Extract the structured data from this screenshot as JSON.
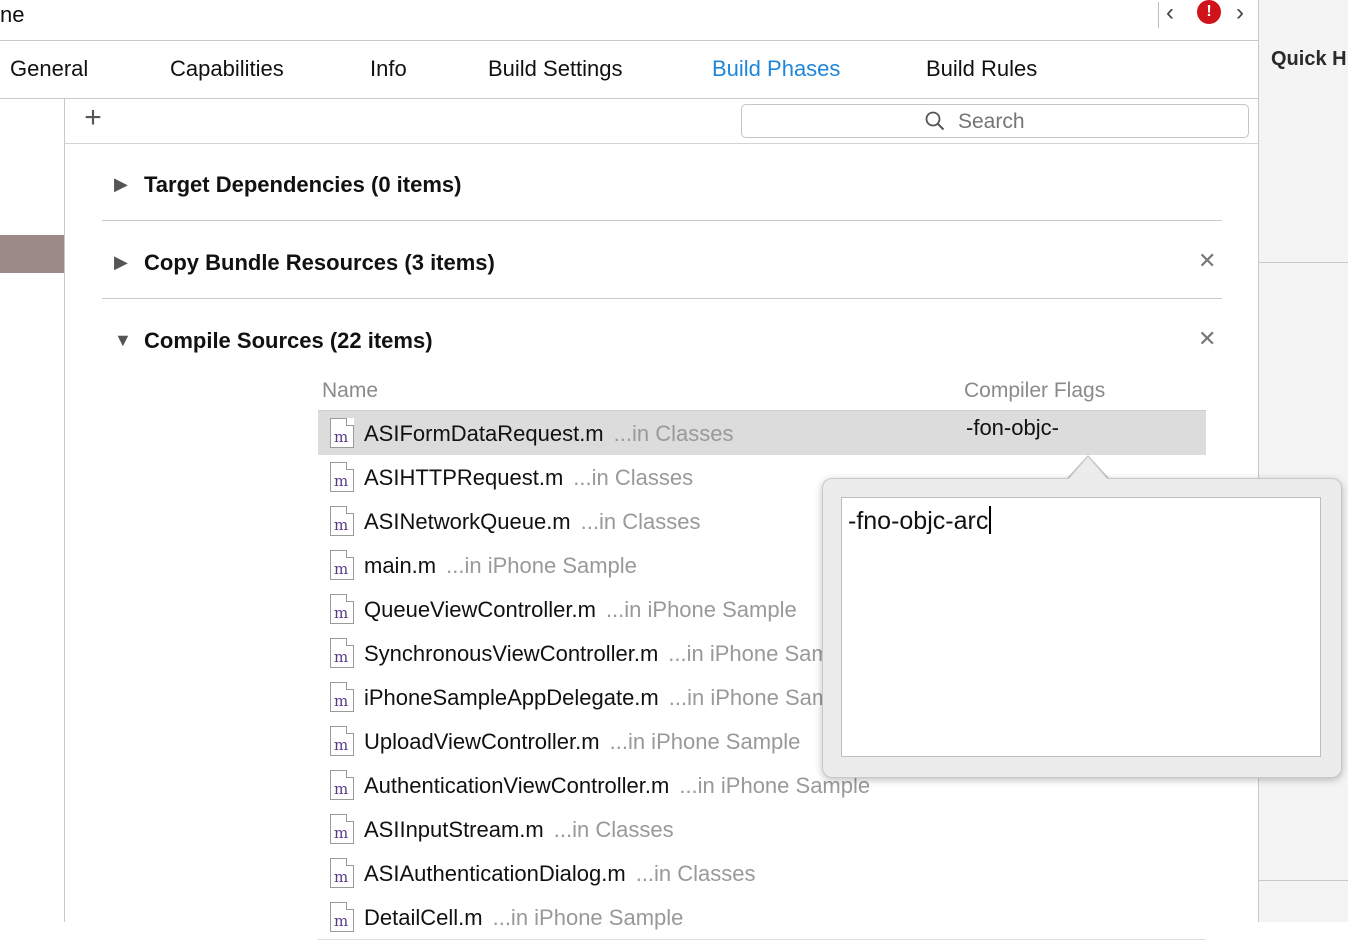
{
  "toolbar": {
    "title_fragment": "ne",
    "nav_back": "‹",
    "error_badge": "!",
    "nav_forward": "›"
  },
  "tabs": [
    {
      "label": "General",
      "active": false
    },
    {
      "label": "Capabilities",
      "active": false
    },
    {
      "label": "Info",
      "active": false
    },
    {
      "label": "Build Settings",
      "active": false
    },
    {
      "label": "Build Phases",
      "active": true
    },
    {
      "label": "Build Rules",
      "active": false
    }
  ],
  "inspector": {
    "title": "Quick H"
  },
  "editor": {
    "add_label": "+",
    "search_placeholder": "Search"
  },
  "phases": [
    {
      "title": "Target Dependencies (0 items)",
      "expanded": false,
      "closable": false
    },
    {
      "title": "Copy Bundle Resources (3 items)",
      "expanded": false,
      "closable": true
    },
    {
      "title": "Compile Sources (22 items)",
      "expanded": true,
      "closable": true
    }
  ],
  "compile_table": {
    "col_name": "Name",
    "col_flags": "Compiler Flags",
    "rows": [
      {
        "icon": "m",
        "file": "ASIFormDataRequest.m",
        "location": "...in Classes",
        "flags": "-fon-objc-",
        "selected": true
      },
      {
        "icon": "m",
        "file": "ASIHTTPRequest.m",
        "location": "...in Classes",
        "flags": "",
        "selected": false
      },
      {
        "icon": "m",
        "file": "ASINetworkQueue.m",
        "location": "...in Classes",
        "flags": "",
        "selected": false
      },
      {
        "icon": "m",
        "file": "main.m",
        "location": "...in iPhone Sample",
        "flags": "",
        "selected": false
      },
      {
        "icon": "m",
        "file": "QueueViewController.m",
        "location": "...in iPhone Sample",
        "flags": "",
        "selected": false
      },
      {
        "icon": "m",
        "file": "SynchronousViewController.m",
        "location": "...in iPhone Sample",
        "flags": "",
        "selected": false
      },
      {
        "icon": "m",
        "file": "iPhoneSampleAppDelegate.m",
        "location": "...in iPhone Sample",
        "flags": "",
        "selected": false
      },
      {
        "icon": "m",
        "file": "UploadViewController.m",
        "location": "...in iPhone Sample",
        "flags": "",
        "selected": false
      },
      {
        "icon": "m",
        "file": "AuthenticationViewController.m",
        "location": "...in iPhone Sample",
        "flags": "",
        "selected": false
      },
      {
        "icon": "m",
        "file": "ASIInputStream.m",
        "location": "...in Classes",
        "flags": "",
        "selected": false
      },
      {
        "icon": "m",
        "file": "ASIAuthenticationDialog.m",
        "location": "...in Classes",
        "flags": "",
        "selected": false
      },
      {
        "icon": "m",
        "file": "DetailCell.m",
        "location": "...in iPhone Sample",
        "flags": "",
        "selected": false
      }
    ]
  },
  "popover": {
    "flags_value": "-fno-objc-arc"
  },
  "colors": {
    "accent": "#1f86d9",
    "error": "#d0131b",
    "selection": "#dcdcdc",
    "target_selected": "#9c8a88"
  }
}
